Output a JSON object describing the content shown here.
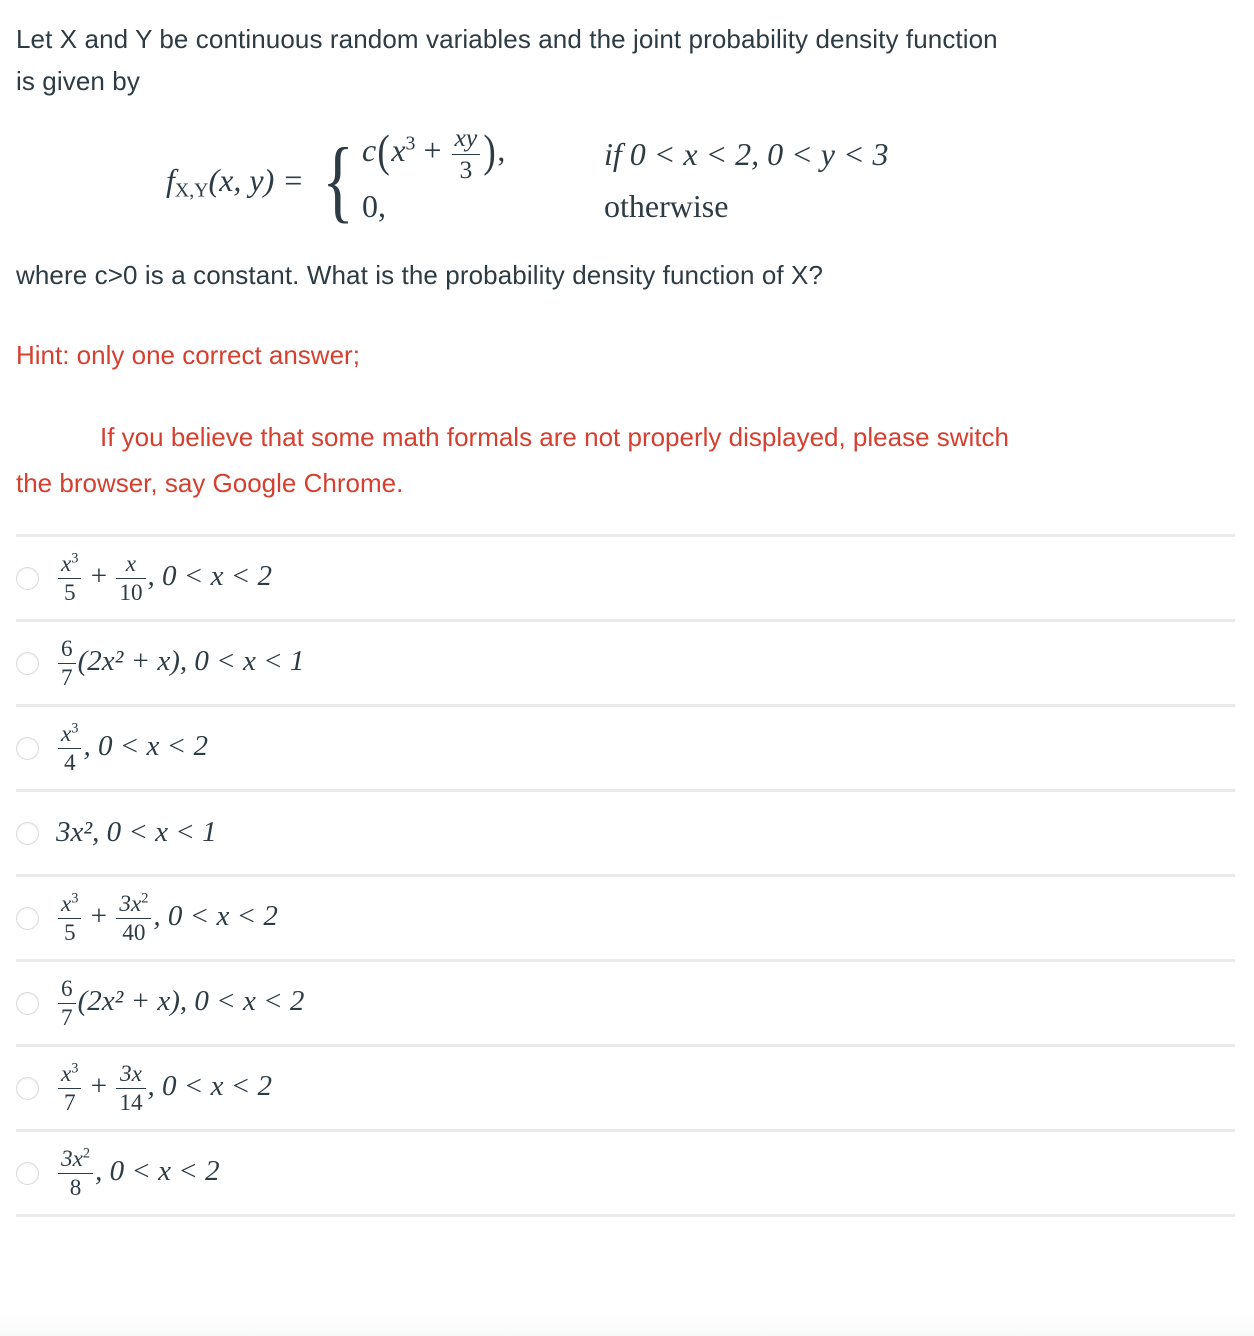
{
  "question": {
    "stem_line_1": "Let X and Y be continuous random variables and the joint probability density function",
    "stem_line_2": "is given by",
    "stem_line_3": "where c>0 is a constant. What is the probability density function of X?"
  },
  "equation": {
    "lhs_f": "f",
    "lhs_sub": "X,Y",
    "lhs_args": "(x, y) =",
    "case1_c": "c",
    "case1_open": "(",
    "case1_x": "x",
    "case1_pow": "3",
    "case1_plus": "+",
    "case1_frac_num": "xy",
    "case1_frac_den": "3",
    "case1_close": ")",
    "case1_comma": ",",
    "case1_condition": "if 0 < x < 2, 0 < y < 3",
    "case2_value": "0,",
    "case2_condition": "otherwise"
  },
  "hint": {
    "line_1": "Hint: only one correct answer;",
    "line_2": "If you believe that some math formals are not properly displayed, please switch",
    "line_3": "the  browser, say Google Chrome."
  },
  "answers": [
    {
      "id": "answer-1",
      "parts": [
        {
          "kind": "frac",
          "num_base": "x",
          "num_pow": "3",
          "den": "5"
        },
        {
          "kind": "op",
          "text": "+"
        },
        {
          "kind": "frac",
          "num_base": "x",
          "num_pow": "",
          "den": "10"
        },
        {
          "kind": "text",
          "text": ", 0 < x < 2"
        }
      ],
      "plain": "x^3/5 + x/10, 0 < x < 2",
      "selected": false
    },
    {
      "id": "answer-2",
      "parts": [
        {
          "kind": "frac",
          "num_base": "6",
          "num_pow": "",
          "den": "7"
        },
        {
          "kind": "text",
          "text": "(2x² + x), 0 < x < 1"
        }
      ],
      "plain": "6/7(2x^2 + x), 0 < x < 1",
      "selected": false
    },
    {
      "id": "answer-3",
      "parts": [
        {
          "kind": "frac",
          "num_base": "x",
          "num_pow": "3",
          "den": "4"
        },
        {
          "kind": "text",
          "text": ", 0 < x < 2"
        }
      ],
      "plain": "x^3/4, 0 < x < 2",
      "selected": false
    },
    {
      "id": "answer-4",
      "parts": [
        {
          "kind": "text",
          "text": "3x², 0 < x < 1"
        }
      ],
      "plain": "3x^2, 0 < x < 1",
      "selected": false
    },
    {
      "id": "answer-5",
      "parts": [
        {
          "kind": "frac",
          "num_base": "x",
          "num_pow": "3",
          "den": "5"
        },
        {
          "kind": "op",
          "text": "+"
        },
        {
          "kind": "frac",
          "num_base": "3x",
          "num_pow": "2",
          "den": "40"
        },
        {
          "kind": "text",
          "text": ", 0 < x < 2"
        }
      ],
      "plain": "x^3/5 + 3x^2/40, 0 < x < 2",
      "selected": false
    },
    {
      "id": "answer-6",
      "parts": [
        {
          "kind": "frac",
          "num_base": "6",
          "num_pow": "",
          "den": "7"
        },
        {
          "kind": "text",
          "text": "(2x² + x), 0 < x < 2"
        }
      ],
      "plain": "6/7(2x^2 + x), 0 < x < 2",
      "selected": false
    },
    {
      "id": "answer-7",
      "parts": [
        {
          "kind": "frac",
          "num_base": "x",
          "num_pow": "3",
          "den": "7"
        },
        {
          "kind": "op",
          "text": "+"
        },
        {
          "kind": "frac",
          "num_base": "3x",
          "num_pow": "",
          "den": "14"
        },
        {
          "kind": "text",
          "text": ", 0 < x < 2"
        }
      ],
      "plain": "x^3/7 + 3x/14, 0 < x < 2",
      "selected": false
    },
    {
      "id": "answer-8",
      "parts": [
        {
          "kind": "frac",
          "num_base": "3x",
          "num_pow": "2",
          "den": "8"
        },
        {
          "kind": "text",
          "text": ", 0 < x < 2"
        }
      ],
      "plain": "3x^2/8, 0 < x < 2",
      "selected": false
    }
  ],
  "colors": {
    "text": "#2d3b45",
    "hint_red": "#d53f30",
    "separator": "#e8eaec",
    "radio_border": "#d9dcdf"
  }
}
